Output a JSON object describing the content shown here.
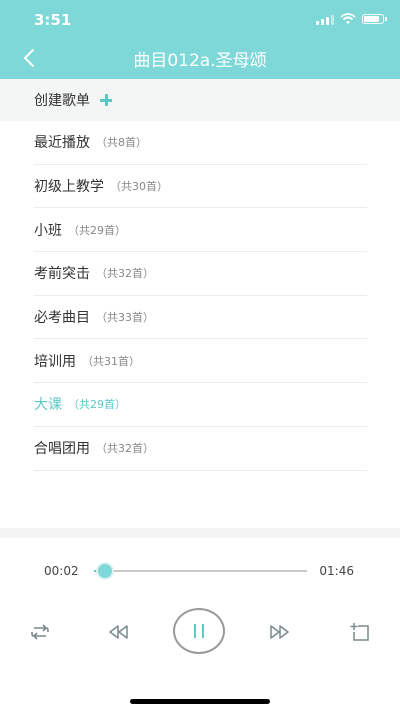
{
  "status": {
    "time": "3:51"
  },
  "header": {
    "title": "曲目012a.圣母颂"
  },
  "create": {
    "label": "创建歌单"
  },
  "playlists": [
    {
      "name": "最近播放",
      "count": "（共8首）",
      "active": false
    },
    {
      "name": "初级上教学",
      "count": "（共30首）",
      "active": false
    },
    {
      "name": "小班",
      "count": "（共29首）",
      "active": false
    },
    {
      "name": "考前突击",
      "count": "（共32首）",
      "active": false
    },
    {
      "name": "必考曲目",
      "count": "（共33首）",
      "active": false
    },
    {
      "name": "培训用",
      "count": "（共31首）",
      "active": false
    },
    {
      "name": "大课",
      "count": "（共29首）",
      "active": true
    },
    {
      "name": "合唱团用",
      "count": "（共32首）",
      "active": false
    }
  ],
  "player": {
    "current_time": "00:02",
    "total_time": "01:46",
    "progress": 0.04,
    "state": "playing"
  },
  "icons": [
    "back-icon",
    "plus-icon",
    "repeat-icon",
    "rewind-icon",
    "pause-icon",
    "fast-forward-icon",
    "add-to-playlist-icon"
  ],
  "colors": {
    "accent": "#7fd8d8",
    "active_text": "#5cc7c7"
  }
}
